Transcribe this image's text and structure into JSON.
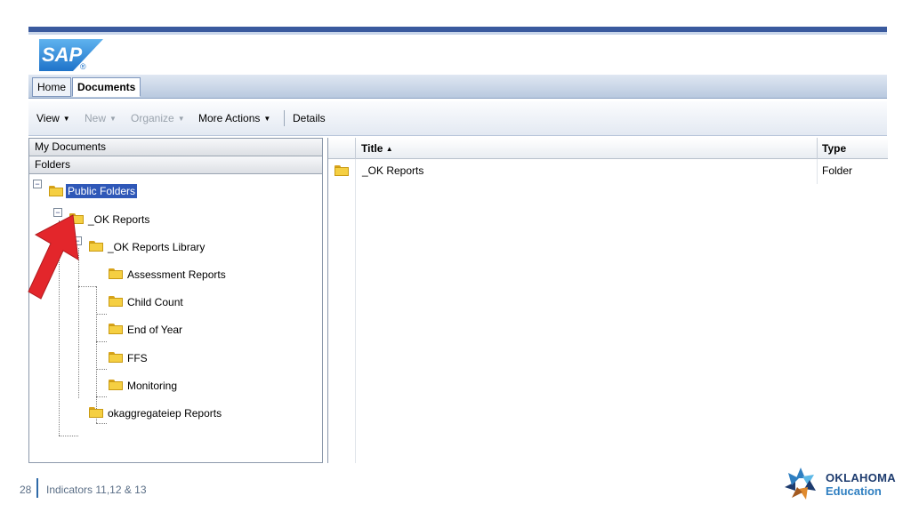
{
  "app": {
    "logo_text": "SAP",
    "logo_mark": "®"
  },
  "tabs": [
    {
      "label": "Home",
      "active": false
    },
    {
      "label": "Documents",
      "active": true
    }
  ],
  "toolbar": {
    "view_label": "View",
    "new_label": "New",
    "organize_label": "Organize",
    "more_actions_label": "More Actions",
    "details_label": "Details"
  },
  "left_panel": {
    "my_documents_label": "My Documents",
    "folders_label": "Folders"
  },
  "tree": {
    "public_folders": "Public Folders",
    "ok_reports": "_OK Reports",
    "ok_reports_library": "_OK Reports Library",
    "assessment_reports": "Assessment Reports",
    "child_count": "Child Count",
    "end_of_year": "End of Year",
    "ffs": "FFS",
    "monitoring": "Monitoring",
    "okaggregateiep_reports": "okaggregateiep Reports"
  },
  "grid": {
    "columns": [
      "Title",
      "Type"
    ],
    "sort_indicator": "▲",
    "rows": [
      {
        "title": "_OK Reports",
        "type": "Folder"
      }
    ]
  },
  "footer": {
    "page_number": "28",
    "caption": "Indicators 11,12 & 13",
    "org_line1": "OKLAHOMA",
    "org_line2": "Education"
  },
  "colors": {
    "accent": "#3a5a9e",
    "selection": "#2f58b8",
    "arrow": "#e3262b",
    "folder": "#f5cf42"
  }
}
